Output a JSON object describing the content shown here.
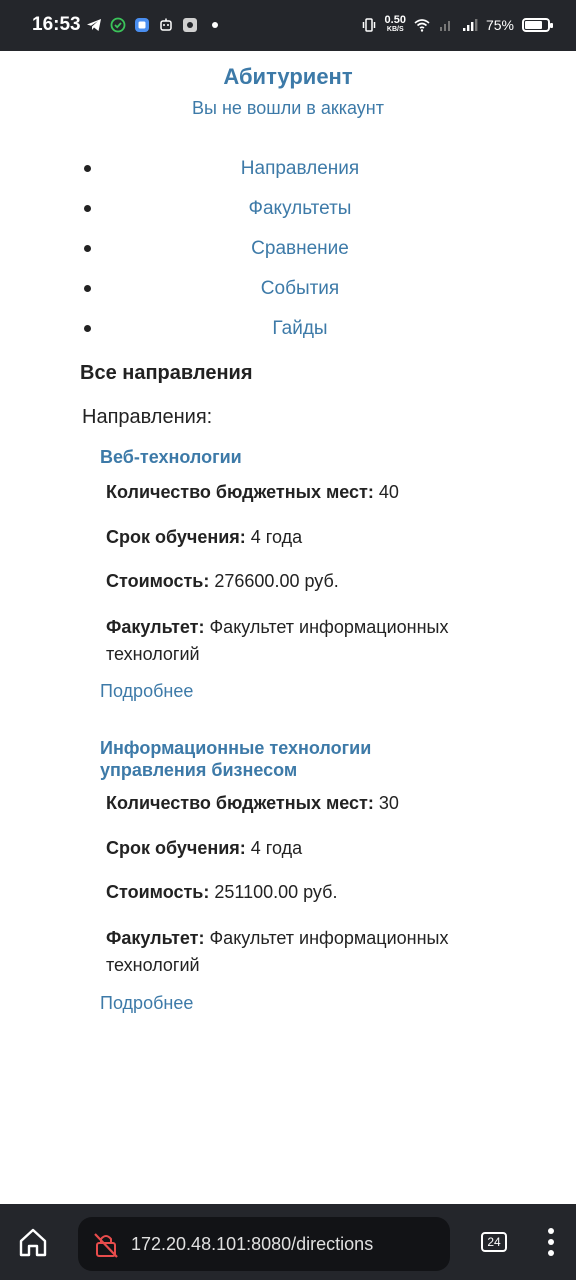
{
  "status_bar": {
    "time": "16:53",
    "speed_value": "0.50",
    "speed_unit": "KB/S",
    "battery": "75%"
  },
  "header": {
    "site_title": "Абитуриент",
    "login_status": "Вы не вошли в аккаунт"
  },
  "nav": {
    "items": [
      {
        "label": "Направления"
      },
      {
        "label": "Факультеты"
      },
      {
        "label": "Сравнение"
      },
      {
        "label": "События"
      },
      {
        "label": "Гайды"
      }
    ]
  },
  "main": {
    "page_heading": "Все направления",
    "section_heading": "Направления:",
    "labels": {
      "budget": "Количество бюджетных мест:",
      "duration": "Срок обучения:",
      "cost": "Стоимость:",
      "faculty": "Факультет:"
    },
    "directions": [
      {
        "title": "Веб-технологии",
        "budget": "40",
        "duration": "4 года",
        "cost": "276600.00 руб.",
        "faculty": "Факультет информационных технологий",
        "more": "Подробнее"
      },
      {
        "title": "Информационные технологии управления бизнесом",
        "budget": "30",
        "duration": "4 года",
        "cost": "251100.00 руб.",
        "faculty": "Факультет информационных технологий",
        "more": "Подробнее"
      }
    ]
  },
  "browser": {
    "url": "172.20.48.101:8080/directions",
    "tab_count": "24"
  },
  "colors": {
    "link": "#3d7aa8",
    "bar_background": "#24262b"
  }
}
